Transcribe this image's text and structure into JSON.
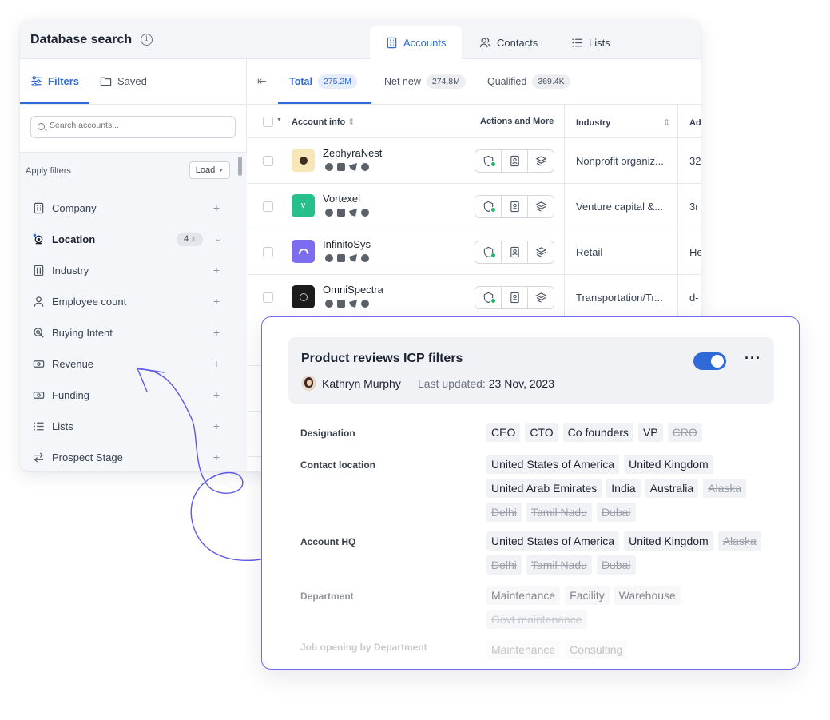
{
  "app": {
    "title": "Database search",
    "tabs": [
      {
        "label": "Accounts",
        "active": true
      },
      {
        "label": "Contacts",
        "active": false
      },
      {
        "label": "Lists",
        "active": false
      }
    ]
  },
  "sidebar": {
    "tabs": [
      {
        "label": "Filters",
        "active": true
      },
      {
        "label": "Saved",
        "active": false
      }
    ],
    "search_placeholder": "Search accounts...",
    "apply_label": "Apply filters",
    "load_label": "Load",
    "filters": [
      {
        "label": "Company",
        "icon": "building-icon"
      },
      {
        "label": "Location",
        "icon": "location-icon",
        "badge": "4",
        "expanded": true
      },
      {
        "label": "Industry",
        "icon": "industry-icon"
      },
      {
        "label": "Employee count",
        "icon": "person-icon"
      },
      {
        "label": "Buying Intent",
        "icon": "intent-icon"
      },
      {
        "label": "Revenue",
        "icon": "money-icon"
      },
      {
        "label": "Funding",
        "icon": "money-icon"
      },
      {
        "label": "Lists",
        "icon": "list-icon"
      },
      {
        "label": "Prospect Stage",
        "icon": "swap-icon"
      }
    ]
  },
  "main": {
    "count_tabs": [
      {
        "label": "Total",
        "count": "275.2M",
        "active": true
      },
      {
        "label": "Net new",
        "count": "274.8M",
        "active": false
      },
      {
        "label": "Qualified",
        "count": "369.4K",
        "active": false
      }
    ],
    "columns": {
      "account": "Account info",
      "actions": "Actions and More",
      "industry": "Industry",
      "address": "Ad"
    },
    "rows": [
      {
        "name": "ZephyraNest",
        "industry": "Nonprofit organiz...",
        "address": "32",
        "logo_color": "#f7e6b8"
      },
      {
        "name": "Vortexel",
        "industry": "Venture capital &...",
        "address": "3r",
        "logo_color": "#28c08a"
      },
      {
        "name": "InfinitoSys",
        "industry": "Retail",
        "address": "He",
        "logo_color": "#7b6cf0"
      },
      {
        "name": "OmniSpectra",
        "industry": "Transportation/Tr...",
        "address": "d-",
        "logo_color": "#1c1c1c"
      }
    ]
  },
  "card": {
    "title": "Product reviews ICP filters",
    "toggle_on": true,
    "author": "Kathryn Murphy",
    "updated_label": "Last updated:",
    "updated_date": "23 Nov, 2023",
    "fields": [
      {
        "label": "Designation",
        "chips": [
          {
            "text": "CEO",
            "excluded": false
          },
          {
            "text": "CTO",
            "excluded": false
          },
          {
            "text": "Co founders",
            "excluded": false
          },
          {
            "text": "VP",
            "excluded": false
          },
          {
            "text": "CRO",
            "excluded": true
          }
        ]
      },
      {
        "label": "Contact location",
        "chips": [
          {
            "text": "United States of America",
            "excluded": false
          },
          {
            "text": "United Kingdom",
            "excluded": false
          },
          {
            "text": "United Arab Emirates",
            "excluded": false
          },
          {
            "text": "India",
            "excluded": false
          },
          {
            "text": "Australia",
            "excluded": false
          },
          {
            "text": "Alaska",
            "excluded": true
          },
          {
            "text": "Delhi",
            "excluded": true
          },
          {
            "text": "Tamil Nadu",
            "excluded": true
          },
          {
            "text": "Dubai",
            "excluded": true
          }
        ]
      },
      {
        "label": "Account HQ",
        "chips": [
          {
            "text": "United States of America",
            "excluded": false
          },
          {
            "text": "United Kingdom",
            "excluded": false
          },
          {
            "text": "Alaska",
            "excluded": true
          },
          {
            "text": "Delhi",
            "excluded": true
          },
          {
            "text": "Tamil Nadu",
            "excluded": true
          },
          {
            "text": "Dubai",
            "excluded": true
          }
        ]
      },
      {
        "label": "Department",
        "chips": [
          {
            "text": "Maintenance",
            "excluded": false
          },
          {
            "text": "Facility",
            "excluded": false
          },
          {
            "text": "Warehouse",
            "excluded": false
          },
          {
            "text": "Govt maintenance",
            "excluded": true
          }
        ]
      },
      {
        "label": "Job opening by Department",
        "chips": [
          {
            "text": "Maintenance",
            "excluded": false
          },
          {
            "text": "Consulting",
            "excluded": false
          }
        ]
      }
    ]
  },
  "colors": {
    "accent": "#2f6ad8",
    "card_border": "#6e6cf0",
    "arrow": "#5b59e6",
    "success": "#1fb86a"
  }
}
